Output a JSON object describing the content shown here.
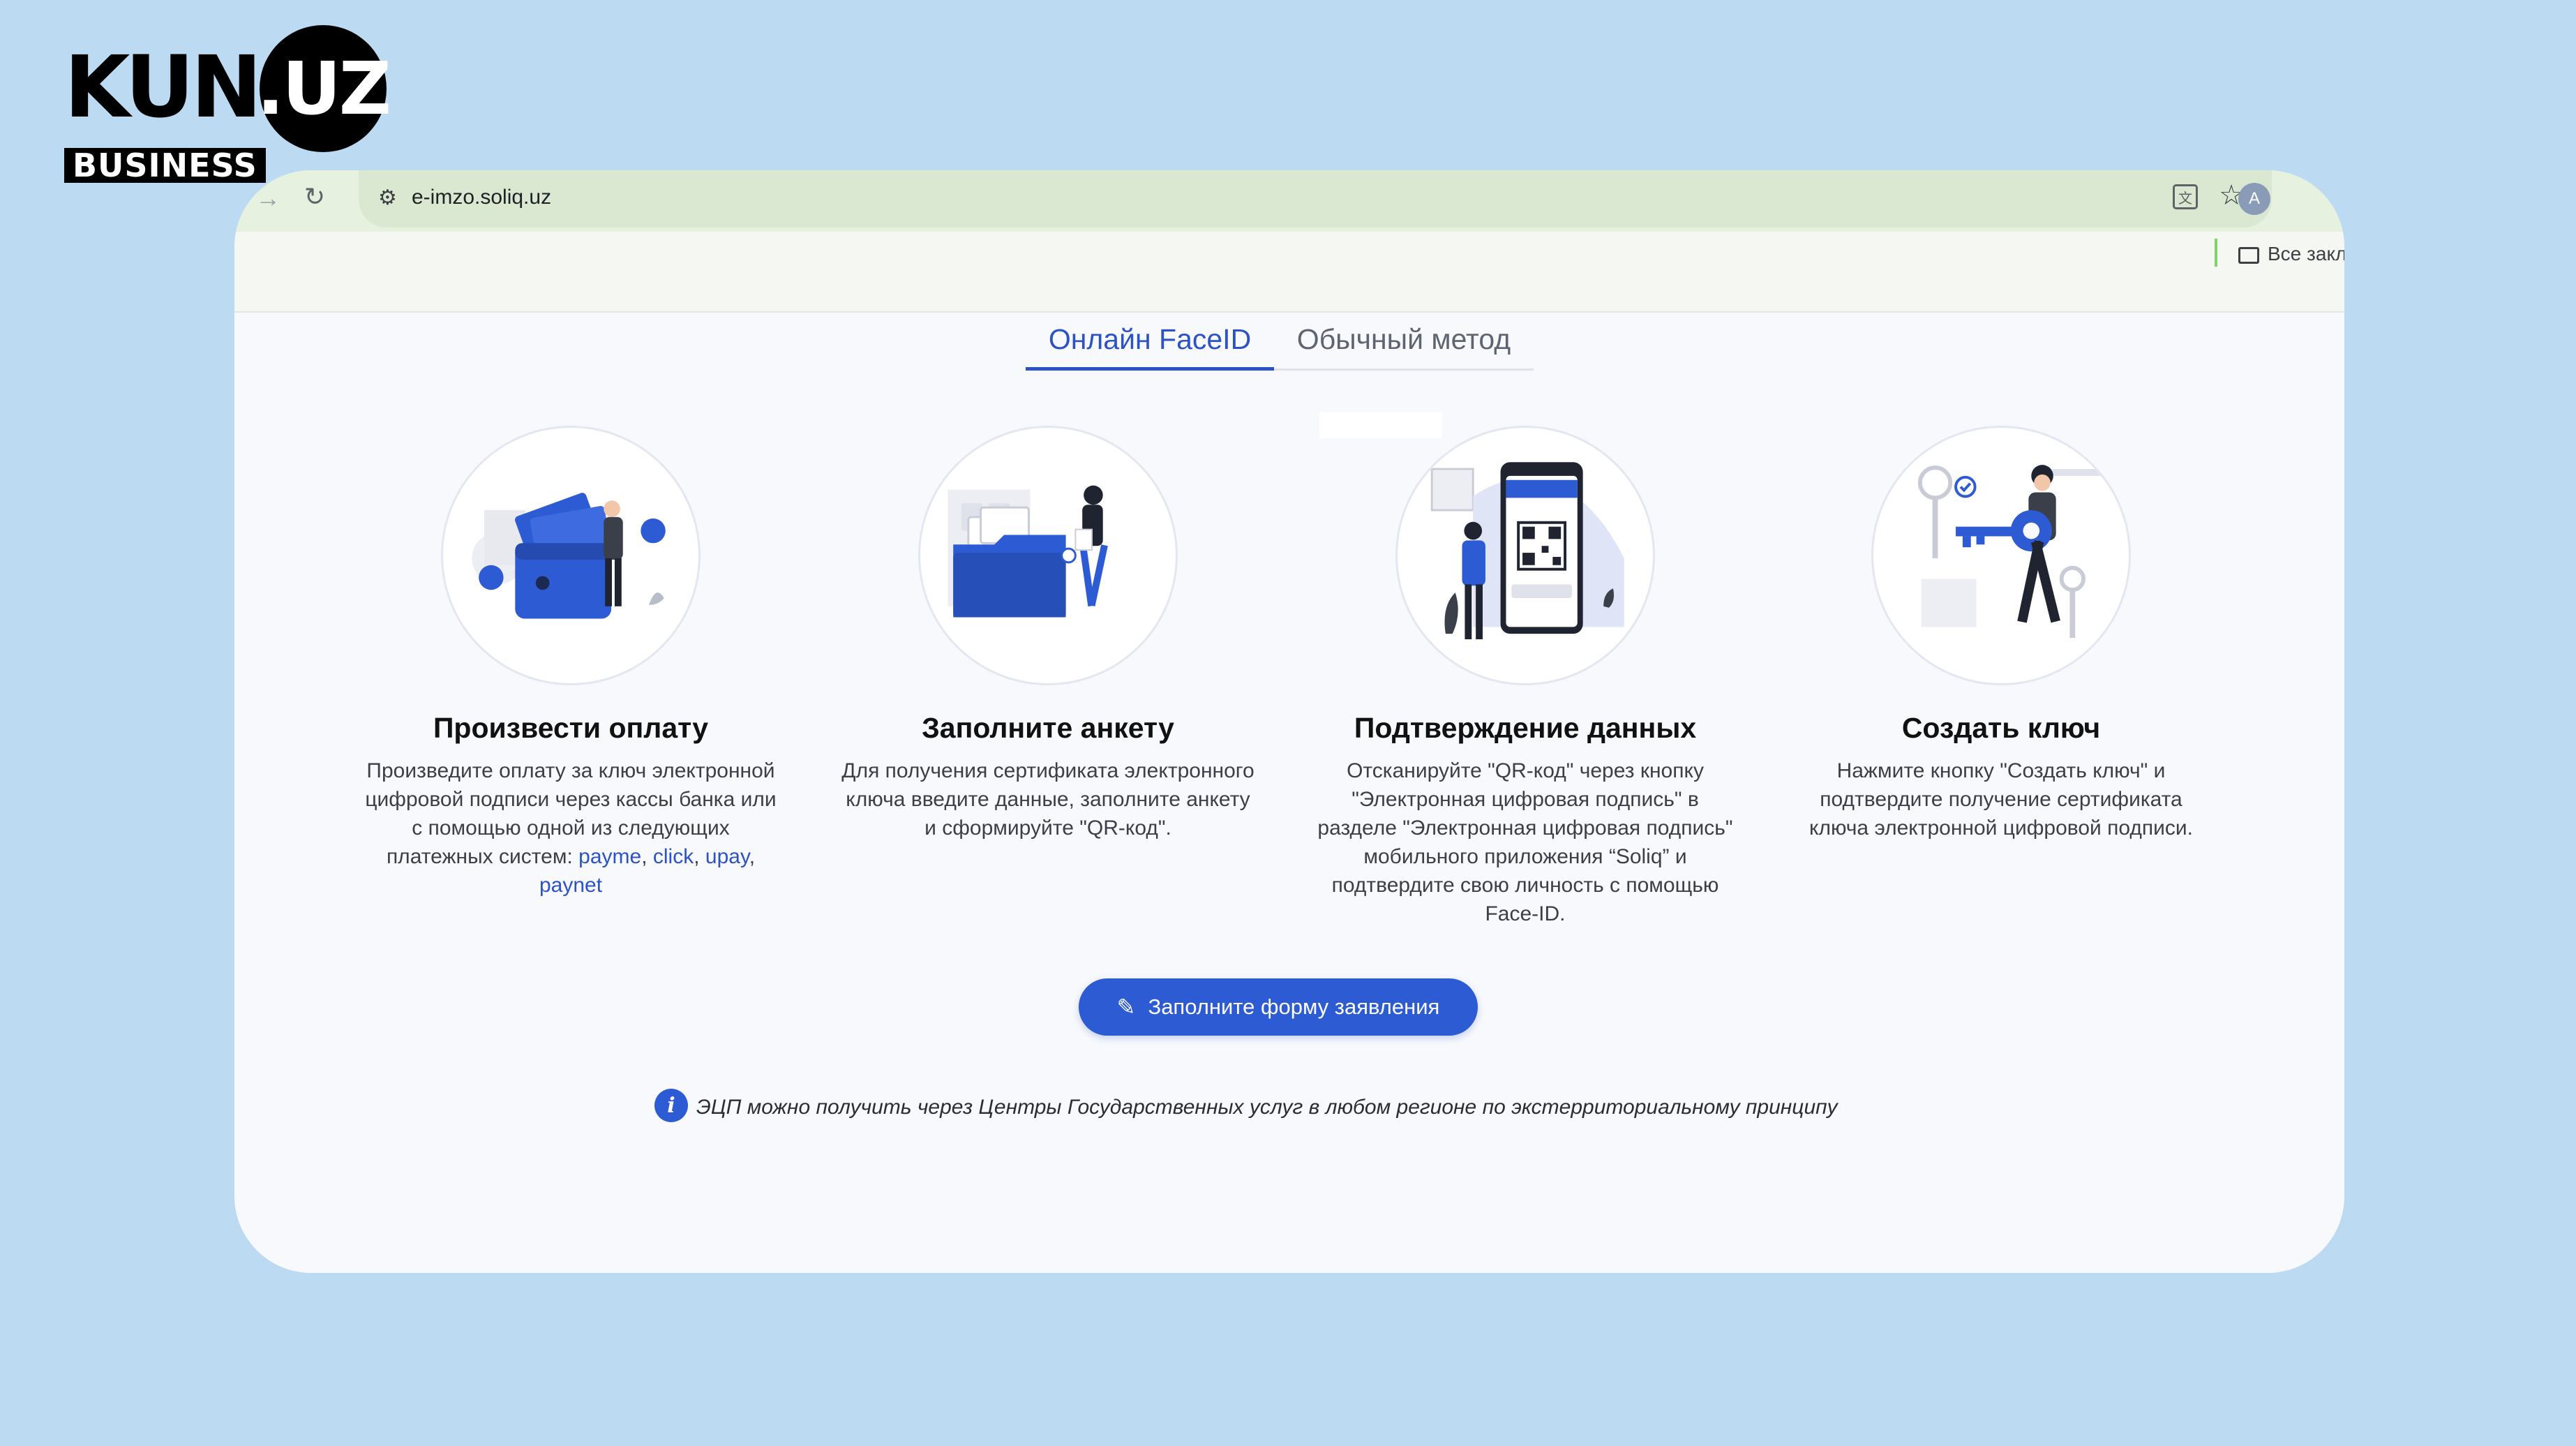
{
  "logo": {
    "kun": "KUN",
    "uz": ".UZ",
    "business": "BUSINESS"
  },
  "browser": {
    "url": "e-imzo.soliq.uz",
    "avatar_letter": "A",
    "bookmarks_label": "Все закла"
  },
  "tabs": [
    {
      "label": "Онлайн FaceID",
      "active": true
    },
    {
      "label": "Обычный метод",
      "active": false
    }
  ],
  "steps": [
    {
      "title": "Произвести оплату",
      "desc": "Произведите оплату за ключ электронной цифровой подписи через кассы банка или с помощью одной из следующих платежных систем:",
      "links": [
        "payme",
        "click",
        "upay",
        "paynet"
      ],
      "icon": "wallet-illustration"
    },
    {
      "title": "Заполните анкету",
      "desc": "Для получения сертификата электронного ключа введите данные, заполните анкету и сформируйте \"QR-код\".",
      "icon": "folder-illustration"
    },
    {
      "title": "Подтверждение данных",
      "desc": "Отсканируйте \"QR-код\" через кнопку \"Электронная цифровая подпись\" в разделе \"Электронная цифровая подпись\" мобильного приложения “Soliq” и подтвердите свою личность с помощью Face-ID.",
      "icon": "qr-phone-illustration"
    },
    {
      "title": "Создать ключ",
      "desc": "Нажмите кнопку \"Создать ключ\" и подтвердите получение сертификата ключа электронной цифровой подписи.",
      "icon": "key-illustration"
    }
  ],
  "cta": {
    "label": "Заполните форму заявления"
  },
  "info": {
    "text": "ЭЦП можно получить через Центры Государственных услуг в любом регионе по экстерриториальному принципу"
  },
  "colors": {
    "accent": "#2d5bd3",
    "background": "#bcdbf3",
    "page": "#f8f9fd"
  }
}
